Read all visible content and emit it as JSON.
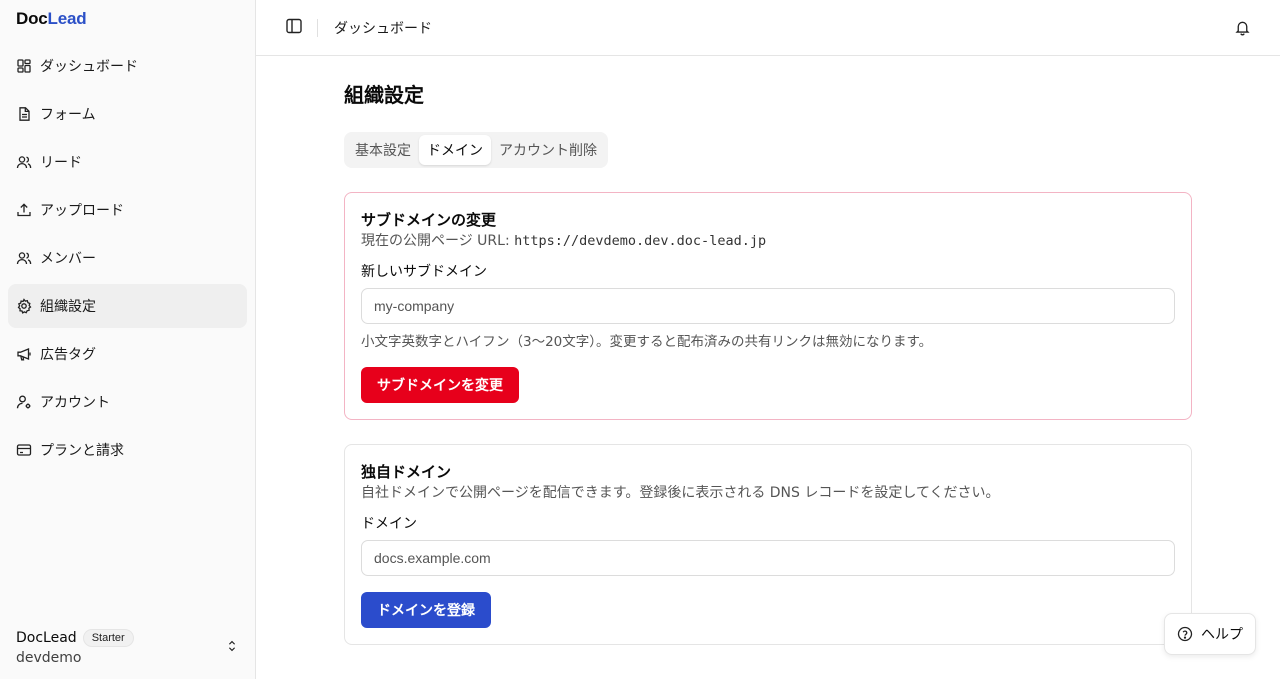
{
  "brand": {
    "doc": "Doc",
    "lead": "Lead"
  },
  "sidebar": {
    "items": [
      {
        "label": "ダッシュボード",
        "icon": "dashboard-icon"
      },
      {
        "label": "フォーム",
        "icon": "file-icon"
      },
      {
        "label": "リード",
        "icon": "users-icon"
      },
      {
        "label": "アップロード",
        "icon": "upload-icon"
      },
      {
        "label": "メンバー",
        "icon": "users-icon"
      },
      {
        "label": "組織設定",
        "icon": "gear-icon",
        "active": true
      },
      {
        "label": "広告タグ",
        "icon": "megaphone-icon"
      },
      {
        "label": "アカウント",
        "icon": "user-cog-icon"
      },
      {
        "label": "プランと請求",
        "icon": "credit-card-icon"
      }
    ],
    "org": {
      "name": "DocLead",
      "plan": "Starter",
      "slug": "devdemo"
    }
  },
  "header": {
    "breadcrumb": "ダッシュボード"
  },
  "main": {
    "title": "組織設定",
    "tabs": [
      {
        "label": "基本設定",
        "active": false
      },
      {
        "label": "ドメイン",
        "active": true
      },
      {
        "label": "アカウント削除",
        "active": false
      }
    ],
    "subdomain_card": {
      "title": "サブドメインの変更",
      "desc_prefix": "現在の公開ページ URL: ",
      "current_url": "https://devdemo.dev.doc-lead.jp",
      "field_label": "新しいサブドメイン",
      "placeholder": "my-company",
      "hint": "小文字英数字とハイフン（3〜20文字）。変更すると配布済みの共有リンクは無効になります。",
      "button": "サブドメインを変更"
    },
    "custom_domain_card": {
      "title": "独自ドメイン",
      "desc": "自社ドメインで公開ページを配信できます。登録後に表示される DNS レコードを設定してください。",
      "field_label": "ドメイン",
      "placeholder": "docs.example.com",
      "button": "ドメインを登録"
    }
  },
  "help": {
    "label": "ヘルプ"
  },
  "colors": {
    "accent": "#2b4ccc",
    "danger": "#e7001b",
    "danger_border": "#f3b4c4"
  }
}
